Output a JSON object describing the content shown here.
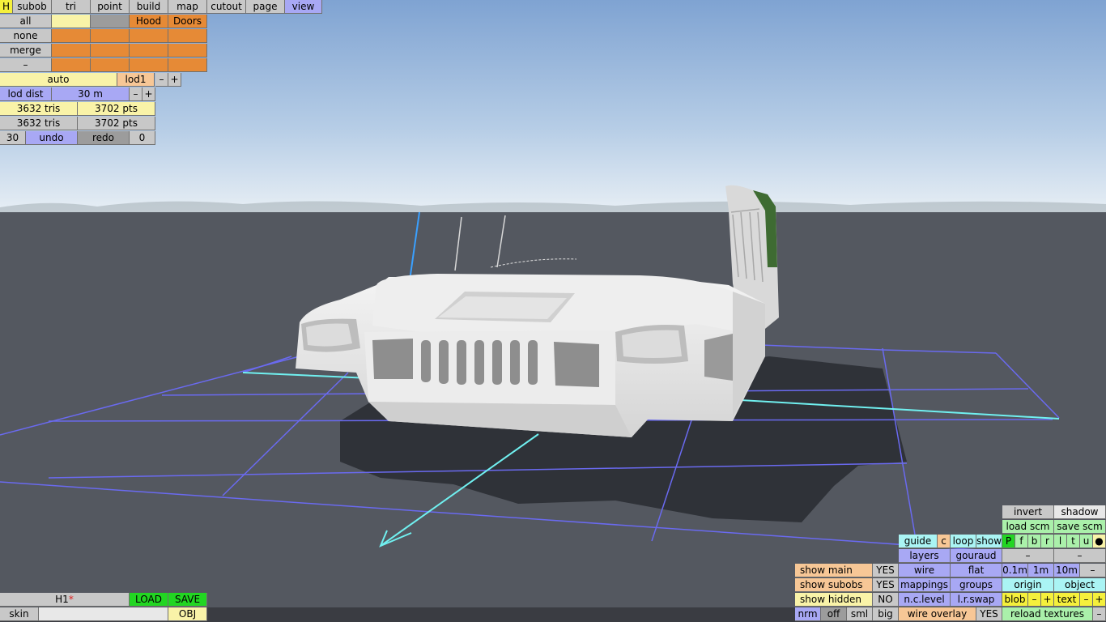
{
  "top_menu": {
    "h": "H",
    "items": [
      "subob",
      "tri",
      "point",
      "build",
      "map",
      "cutout",
      "page",
      "view"
    ]
  },
  "subob_panel": {
    "rows": [
      "all",
      "none",
      "merge",
      "–"
    ],
    "columns": [
      "",
      "",
      "Hood",
      "Doors"
    ]
  },
  "lod": {
    "mode": "auto",
    "level": "lod1",
    "minus": "–",
    "plus": "+",
    "dist_label": "lod dist",
    "dist_value": "30 m"
  },
  "stats": {
    "tris_selected": "3632 tris",
    "pts_selected": "3702 pts",
    "tris_total": "3632 tris",
    "pts_total": "3702 pts"
  },
  "history": {
    "count_left": "30",
    "undo": "undo",
    "redo": "redo",
    "count_right": "0"
  },
  "bottom_left": {
    "file_name": "H1",
    "modified_mark": "*",
    "load": "LOAD",
    "save": "SAVE",
    "skin": "skin",
    "skin_value": "",
    "obj": "OBJ"
  },
  "view_panel": {
    "invert": "invert",
    "shadow": "shadow",
    "load_scm": "load scm",
    "save_scm": "save scm",
    "guide": "guide",
    "c": "c",
    "loop": "loop",
    "show": "show",
    "view_letters": [
      "P",
      "f",
      "b",
      "r",
      "l",
      "t",
      "u",
      "●"
    ],
    "layers": "layers",
    "gouraud": "gouraud",
    "minus": "–",
    "wire": "wire",
    "flat": "flat",
    "grid_steps": [
      "0.1m",
      "1m",
      "10m"
    ],
    "mappings": "mappings",
    "groups": "groups",
    "origin": "origin",
    "object": "object",
    "nc_level": "n.c.level",
    "lr_swap": "l.r.swap",
    "blob": "blob",
    "text": "text",
    "plus": "+",
    "wire_overlay": "wire overlay",
    "reload_textures": "reload textures",
    "show_main": "show main",
    "show_subobs": "show subobs",
    "show_hidden": "show hidden",
    "yes": "YES",
    "no": "NO",
    "normal_modes": [
      "nrm",
      "off",
      "sml",
      "big"
    ]
  },
  "colors": {
    "sky_top": "#7ea2d0",
    "sky_horizon": "#e6eef4",
    "ground": "#545860",
    "grid": "#6a6af0",
    "axis": "#70f0f0",
    "model_body": "#e4e4e4",
    "model_green": "#3e6b32"
  }
}
